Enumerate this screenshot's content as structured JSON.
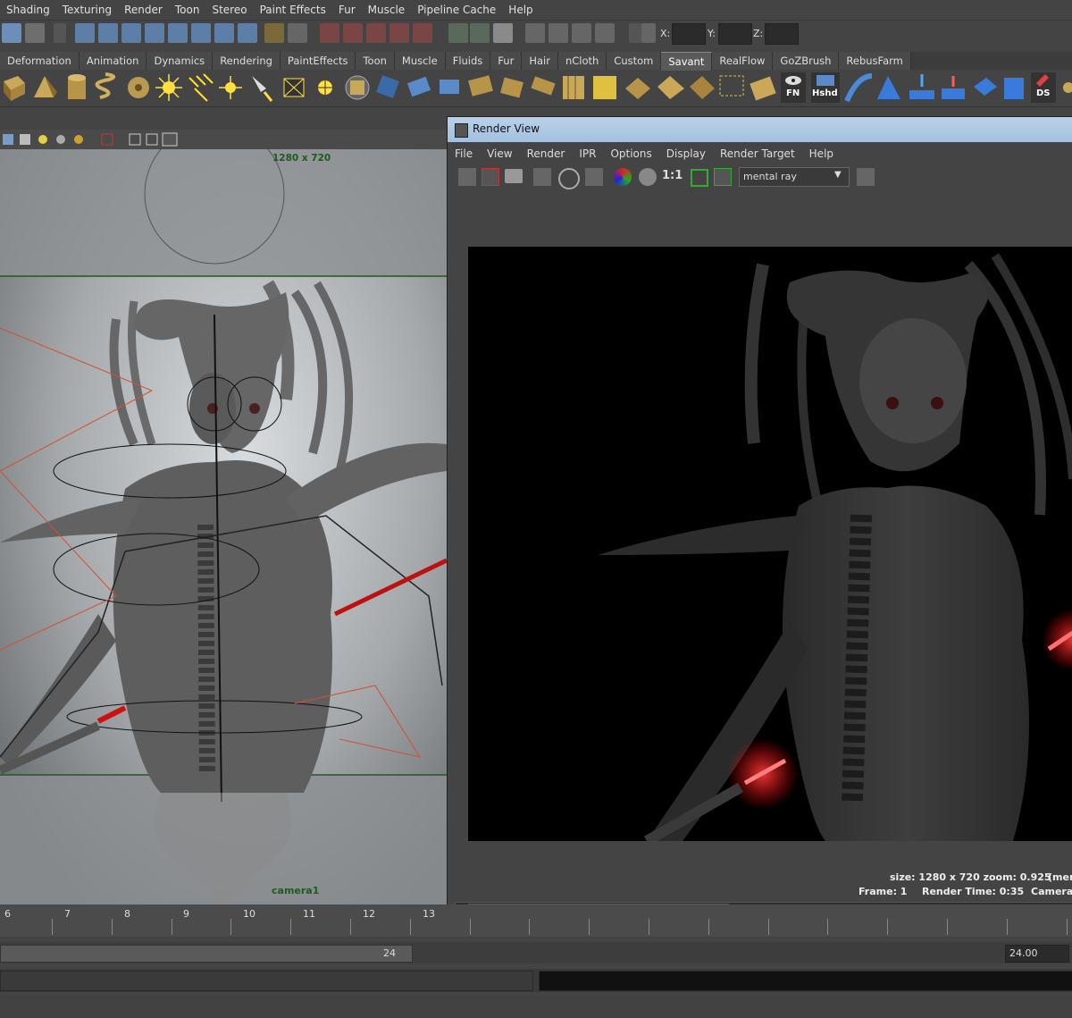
{
  "menubar": [
    "Shading",
    "Texturing",
    "Render",
    "Toon",
    "Stereo",
    "Paint Effects",
    "Fur",
    "Muscle",
    "Pipeline Cache",
    "Help"
  ],
  "status": {
    "x_label": "X:",
    "y_label": "Y:",
    "z_label": "Z:"
  },
  "shelf_tabs": [
    "Deformation",
    "Animation",
    "Dynamics",
    "Rendering",
    "PaintEffects",
    "Toon",
    "Muscle",
    "Fluids",
    "Fur",
    "Hair",
    "nCloth",
    "Custom",
    "Savant",
    "RealFlow",
    "GoZBrush",
    "RebusFarm"
  ],
  "shelf_active": "Savant",
  "shelf_labels": {
    "fn": "FN",
    "hshd": "Hshd",
    "ds": "DS"
  },
  "viewport": {
    "resolution_gate": "1280 x 720",
    "camera": "camera1"
  },
  "render_view": {
    "title": "Render View",
    "menu": [
      "File",
      "View",
      "Render",
      "IPR",
      "Options",
      "Display",
      "Render Target",
      "Help"
    ],
    "ratio_label": "1:1",
    "renderer": "mental ray",
    "info_line1": "size: 1280 x 720  zoom: 0.925",
    "info_line1_extra": "(men",
    "frame": "Frame: 1",
    "render_time": "Render Time: 0:35",
    "camera": "Camera:"
  },
  "timeline": {
    "labels": [
      "6",
      "7",
      "8",
      "9",
      "10",
      "11",
      "12",
      "13"
    ]
  },
  "range": {
    "current": "24",
    "end": "24.00"
  },
  "colors": {
    "accent": "#5a5a5a",
    "title_bar": "#b9d1ea",
    "resolution_gate_text": "#1e5a1e",
    "saber_red": "#ff2a2a"
  }
}
